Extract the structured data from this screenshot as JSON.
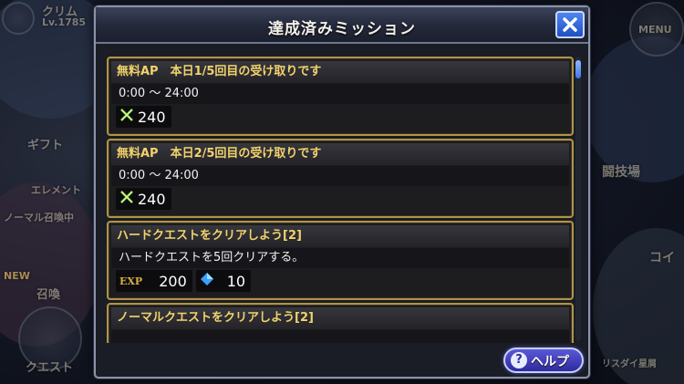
{
  "background": {
    "player_name": "クリム",
    "player_level": "Lv.1785",
    "gift_label": "ギフト",
    "event_label": "エレメント",
    "normal_label": "ノーマル召喚中",
    "new_label": "NEW",
    "summon_label": "召喚",
    "quest_label": "クエスト",
    "menu_label": "MENU",
    "arena_label": "闘技場",
    "coin_label": "コイ",
    "bottom_right_label": "リスダイ星屑"
  },
  "dialog": {
    "title": "達成済みミッション",
    "close_icon": "close-x-icon",
    "help_label": "ヘルプ",
    "help_icon": "question-icon"
  },
  "missions": [
    {
      "title": "無料AP　本日1/5回目の受け取りです",
      "desc": "0:00 〜 24:00",
      "rewards": [
        {
          "icon": "ap-swords-icon",
          "value": "240"
        }
      ]
    },
    {
      "title": "無料AP　本日2/5回目の受け取りです",
      "desc": "0:00 〜 24:00",
      "rewards": [
        {
          "icon": "ap-swords-icon",
          "value": "240"
        }
      ]
    },
    {
      "title": "ハードクエストをクリアしよう[2]",
      "desc": "ハードクエストを5回クリアする。",
      "rewards": [
        {
          "icon": "exp-icon",
          "label": "EXP",
          "value": "200"
        },
        {
          "icon": "crystal-icon",
          "value": "10"
        }
      ]
    },
    {
      "title": "ノーマルクエストをクリアしよう[2]",
      "desc": "",
      "rewards": []
    }
  ],
  "colors": {
    "accent_gold": "#f2d36b",
    "card_border": "#b09447",
    "close_blue": "#2f63d6",
    "help_purple": "#3c38b8"
  }
}
